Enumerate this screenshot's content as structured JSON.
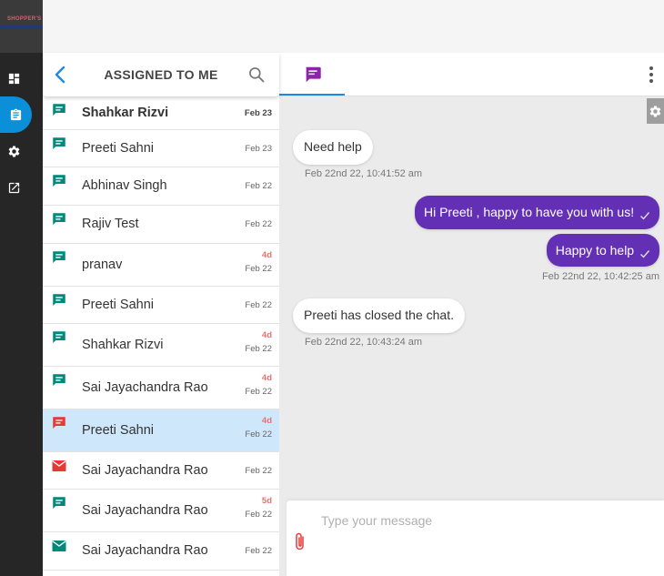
{
  "brand": {
    "logo_text": "SHOPPER'S"
  },
  "colors": {
    "accent_blue": "#0a8fd8",
    "chat_purple": "#6330b5",
    "tab_purple": "#8e24aa",
    "unread_red": "#e57373",
    "icon_teal": "#00897b",
    "icon_red": "#e53935",
    "selected_bg": "#cfe7fb"
  },
  "rail": {
    "items": [
      {
        "icon": "dashboard-icon"
      },
      {
        "icon": "clipboard-icon",
        "active": true
      },
      {
        "icon": "gear-icon"
      },
      {
        "icon": "external-link-icon"
      }
    ]
  },
  "list": {
    "title": "ASSIGNED TO ME",
    "conversations": [
      {
        "name": "Shahkar Rizvi",
        "date": "Feb 23",
        "badge": "",
        "bold": true,
        "icon": "chat-icon",
        "icon_color": "#00897b"
      },
      {
        "name": "Preeti Sahni",
        "date": "Feb 23",
        "badge": "",
        "icon": "chat-icon",
        "icon_color": "#00897b"
      },
      {
        "name": "Abhinav Singh",
        "date": "Feb 22",
        "badge": "",
        "icon": "chat-icon",
        "icon_color": "#00897b"
      },
      {
        "name": "Rajiv Test",
        "date": "Feb 22",
        "badge": "",
        "icon": "chat-icon",
        "icon_color": "#00897b"
      },
      {
        "name": "pranav",
        "date": "Feb 22",
        "badge": "4d",
        "icon": "chat-icon",
        "icon_color": "#00897b"
      },
      {
        "name": "Preeti Sahni",
        "date": "Feb 22",
        "badge": "",
        "icon": "chat-icon",
        "icon_color": "#00897b"
      },
      {
        "name": "Shahkar Rizvi",
        "date": "Feb 22",
        "badge": "4d",
        "icon": "chat-icon",
        "icon_color": "#00897b"
      },
      {
        "name": "Sai Jayachandra Rao",
        "date": "Feb 22",
        "badge": "4d",
        "icon": "chat-icon",
        "icon_color": "#00897b"
      },
      {
        "name": "Preeti Sahni",
        "date": "Feb 22",
        "badge": "4d",
        "selected": true,
        "icon": "chat-icon",
        "icon_color": "#e53935"
      },
      {
        "name": "Sai Jayachandra Rao",
        "date": "Feb 22",
        "badge": "",
        "icon": "email-icon",
        "icon_color": "#e53935"
      },
      {
        "name": "Sai Jayachandra Rao",
        "date": "Feb 22",
        "badge": "5d",
        "icon": "chat-icon",
        "icon_color": "#00897b"
      },
      {
        "name": "Sai Jayachandra Rao",
        "date": "Feb 22",
        "badge": "",
        "icon": "email-icon",
        "icon_color": "#00897b"
      }
    ]
  },
  "chat": {
    "tab_icon": "chat-bubble-icon",
    "messages": [
      {
        "from": "customer",
        "text": "Need help",
        "time": "Feb 22nd 22, 10:41:52 am"
      },
      {
        "from": "agent",
        "text": "Hi Preeti , happy to have you with us!",
        "time": ""
      },
      {
        "from": "agent",
        "text": "Happy to help",
        "time": "Feb 22nd 22, 10:42:25 am"
      },
      {
        "from": "system",
        "text": "Preeti has closed the chat.",
        "time": "Feb 22nd 22, 10:43:24 am"
      }
    ]
  },
  "composer": {
    "placeholder": "Type your message",
    "value": ""
  }
}
